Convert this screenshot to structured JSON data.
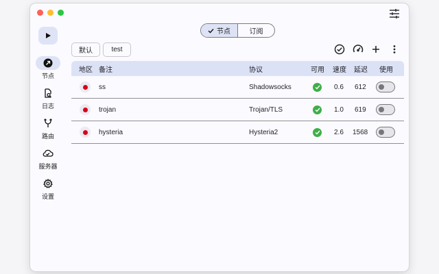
{
  "sidebar": {
    "items": [
      {
        "label": "节点",
        "icon": "arrow-circle-icon"
      },
      {
        "label": "日志",
        "icon": "log-search-icon"
      },
      {
        "label": "路由",
        "icon": "fork-icon"
      },
      {
        "label": "服务器",
        "icon": "cloud-check-icon"
      },
      {
        "label": "设置",
        "icon": "gear-icon"
      }
    ]
  },
  "tabs": {
    "nodes": "节点",
    "subscribe": "订阅"
  },
  "groups": {
    "default": "默认",
    "test": "test"
  },
  "table": {
    "headers": {
      "region": "地区",
      "remark": "备注",
      "protocol": "协议",
      "available": "可用",
      "speed": "速度",
      "latency": "延迟",
      "use": "使用"
    },
    "rows": [
      {
        "remark": "ss",
        "protocol": "Shadowsocks",
        "speed": "0.6",
        "latency": "612",
        "available": true,
        "enabled": false
      },
      {
        "remark": "trojan",
        "protocol": "Trojan/TLS",
        "speed": "1.0",
        "latency": "619",
        "available": true,
        "enabled": false
      },
      {
        "remark": "hysteria",
        "protocol": "Hysteria2",
        "speed": "2.6",
        "latency": "1568",
        "available": true,
        "enabled": false
      }
    ]
  },
  "colors": {
    "accent": "#dce2f6",
    "ok": "#3fae49",
    "flag": "#d6001c"
  }
}
